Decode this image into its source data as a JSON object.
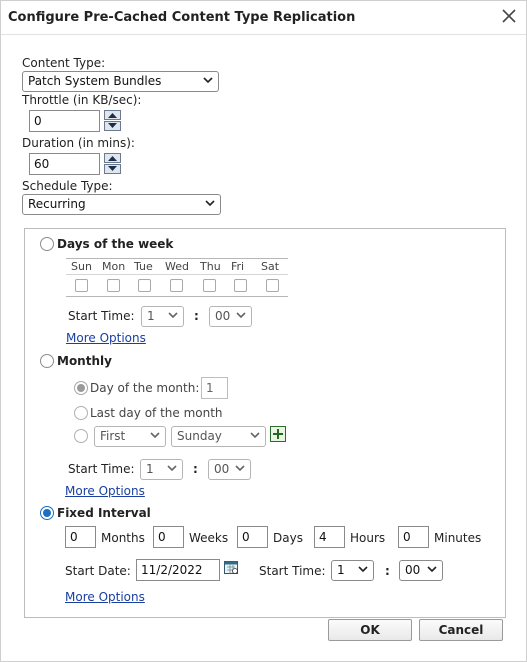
{
  "dialog": {
    "title": "Configure Pre-Cached Content Type Replication"
  },
  "content_type": {
    "label": "Content Type:",
    "value": "Patch System Bundles"
  },
  "throttle": {
    "label": "Throttle (in KB/sec):",
    "value": "0"
  },
  "duration": {
    "label": "Duration (in mins):",
    "value": "60"
  },
  "schedule_type": {
    "label": "Schedule Type:",
    "value": "Recurring"
  },
  "days_of_week": {
    "label": "Days of the week",
    "days": [
      "Sun",
      "Mon",
      "Tue",
      "Wed",
      "Thu",
      "Fri",
      "Sat"
    ],
    "start_time_label": "Start Time:",
    "hour": "1",
    "minute": "00",
    "separator": ":",
    "more_options": "More Options"
  },
  "monthly": {
    "label": "Monthly",
    "day_of_month_label": "Day of the month:",
    "day_of_month_value": "1",
    "last_day_label": "Last day of the month",
    "ordinal": "First",
    "weekday": "Sunday",
    "start_time_label": "Start Time:",
    "hour": "1",
    "minute": "00",
    "separator": ":",
    "more_options": "More Options"
  },
  "fixed_interval": {
    "label": "Fixed Interval",
    "months_value": "0",
    "months_label": "Months",
    "weeks_value": "0",
    "weeks_label": "Weeks",
    "days_value": "0",
    "days_label": "Days",
    "hours_value": "4",
    "hours_label": "Hours",
    "minutes_value": "0",
    "minutes_label": "Minutes",
    "start_date_label": "Start Date:",
    "start_date_value": "11/2/2022",
    "start_time_label": "Start Time:",
    "hour": "1",
    "minute": "00",
    "separator": ":",
    "more_options": "More Options"
  },
  "buttons": {
    "ok": "OK",
    "cancel": "Cancel"
  },
  "colors": {
    "accent": "#1b6ec2",
    "link": "#1a3fa0"
  }
}
